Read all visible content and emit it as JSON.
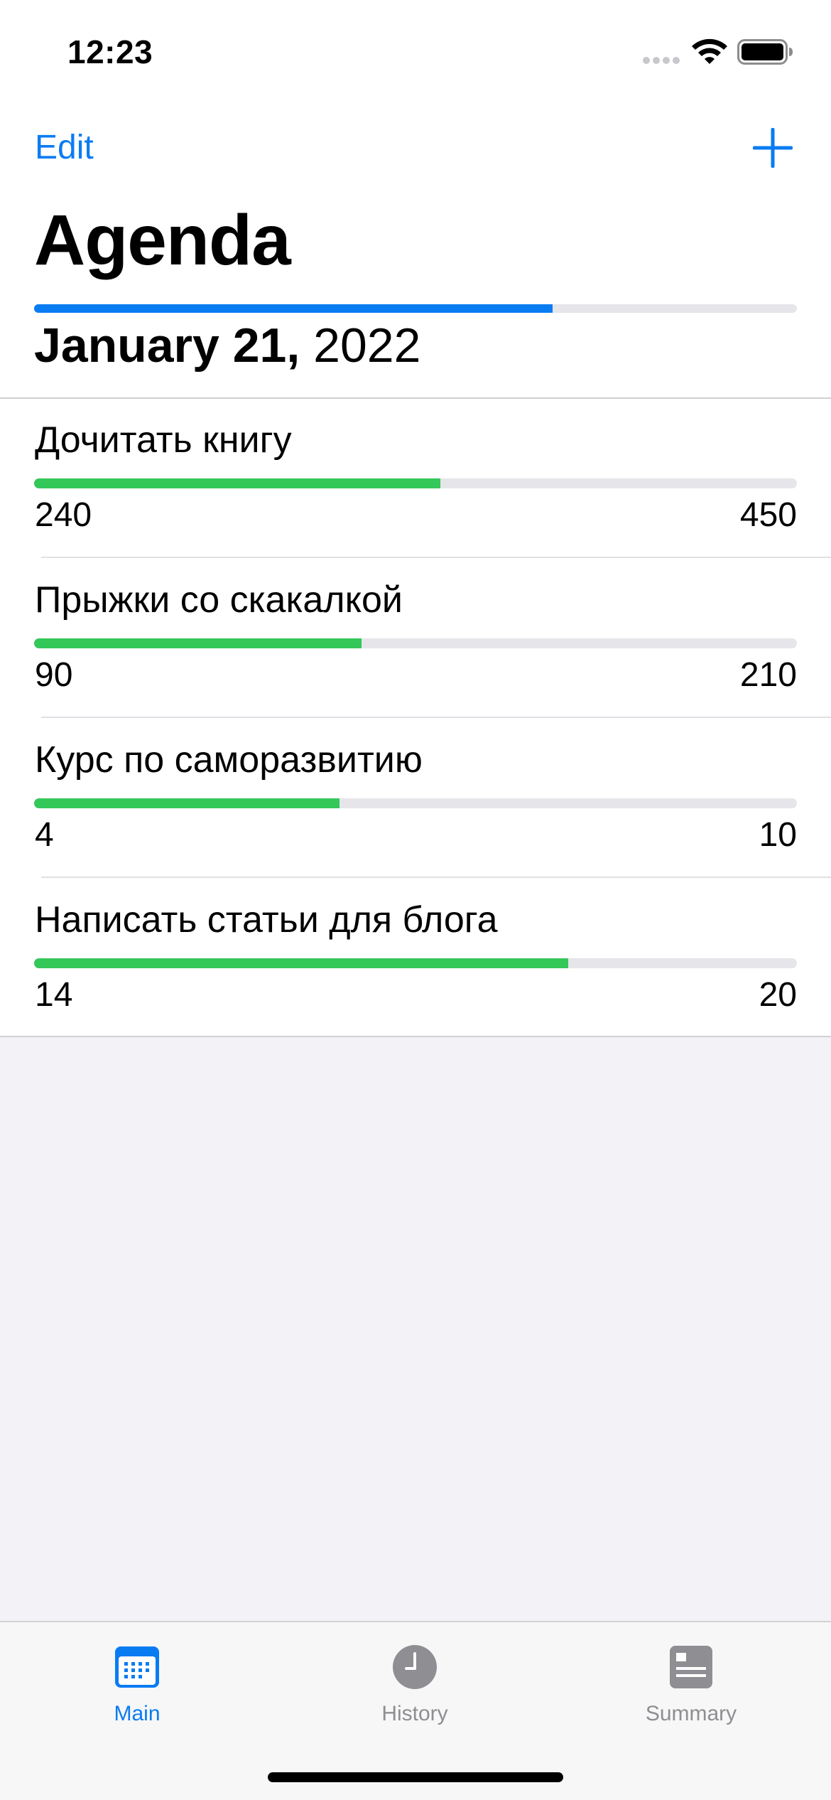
{
  "status_bar": {
    "time": "12:23"
  },
  "nav": {
    "edit_label": "Edit",
    "add_icon": "plus-icon",
    "title": "Agenda"
  },
  "day_progress": {
    "fraction": 0.68
  },
  "date": {
    "month_day": "January 21,",
    "year": "2022"
  },
  "items": [
    {
      "title": "Дочитать книгу",
      "current": "240",
      "target": "450",
      "progress": 0.533
    },
    {
      "title": "Прыжки со скакалкой",
      "current": "90",
      "target": "210",
      "progress": 0.429
    },
    {
      "title": "Курс по саморазвитию",
      "current": "4",
      "target": "10",
      "progress": 0.4
    },
    {
      "title": "Написать статьи для блога",
      "current": "14",
      "target": "20",
      "progress": 0.7
    }
  ],
  "tabs": [
    {
      "label": "Main",
      "icon": "calendar-icon",
      "active": true
    },
    {
      "label": "History",
      "icon": "clock-icon",
      "active": false
    },
    {
      "label": "Summary",
      "icon": "document-icon",
      "active": false
    }
  ],
  "colors": {
    "accent": "#0a7cf2",
    "progress_green": "#34c759",
    "track": "#e5e5ea",
    "inactive_tab": "#8e8e93"
  }
}
